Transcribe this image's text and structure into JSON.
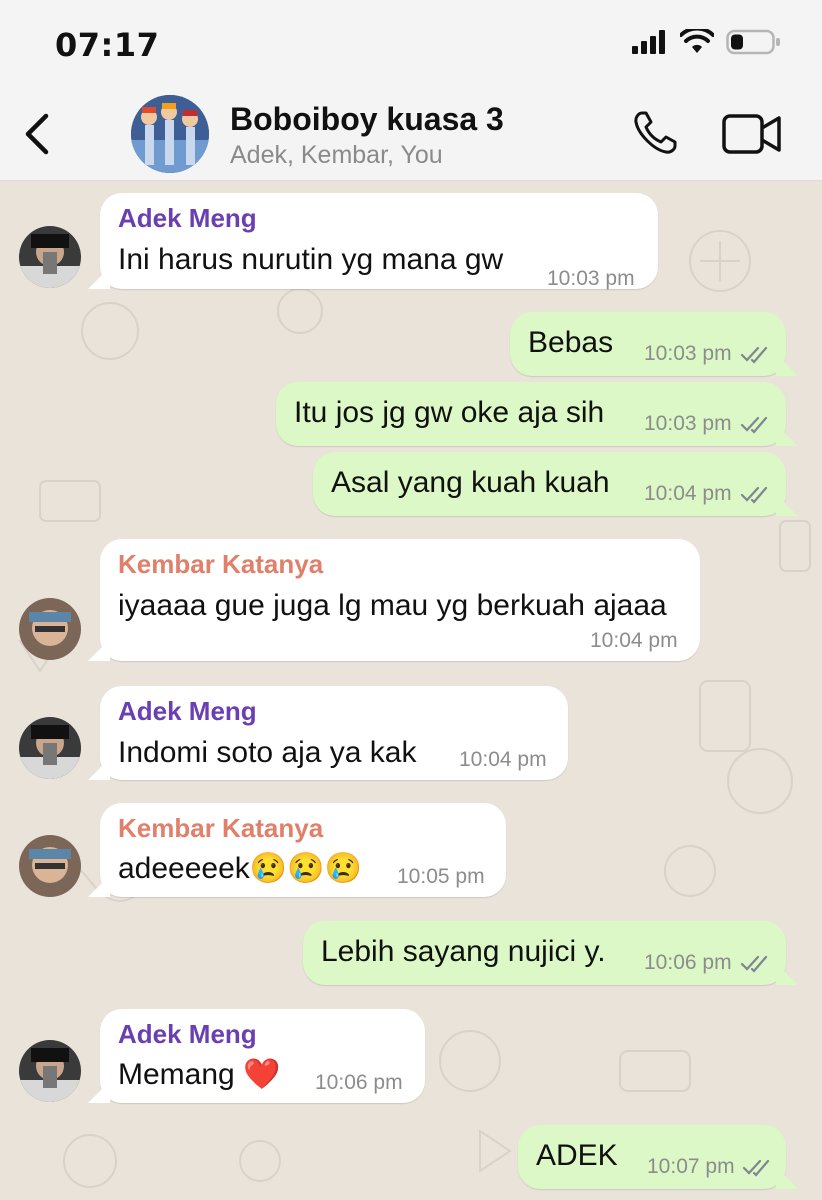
{
  "status_bar": {
    "time": "07:17"
  },
  "header": {
    "title": "Boboiboy kuasa 3",
    "subtitle": "Adek, Kembar, You"
  },
  "colors": {
    "adek_name": "#6a3fb3",
    "kembar_name": "#e07f6a",
    "outgoing_bubble": "#dbf8c6",
    "incoming_bubble": "#ffffff",
    "read_ticks": "#7d8791"
  },
  "messages": [
    {
      "direction": "in",
      "sender": "Adek Meng",
      "text": "Ini harus nurutin yg mana gw",
      "time": "10:03 pm"
    },
    {
      "direction": "out",
      "text": "Bebas",
      "time": "10:03 pm",
      "status": "read"
    },
    {
      "direction": "out",
      "text": "Itu jos jg gw oke aja sih",
      "time": "10:03 pm",
      "status": "read"
    },
    {
      "direction": "out",
      "text": "Asal yang kuah kuah",
      "time": "10:04 pm",
      "status": "read"
    },
    {
      "direction": "in",
      "sender": "Kembar Katanya",
      "text": "iyaaaa gue juga lg mau yg berkuah ajaaa",
      "time": "10:04 pm"
    },
    {
      "direction": "in",
      "sender": "Adek Meng",
      "text": "Indomi soto aja ya kak",
      "time": "10:04 pm"
    },
    {
      "direction": "in",
      "sender": "Kembar Katanya",
      "text": "adeeeeek😢😢😢",
      "time": "10:05 pm"
    },
    {
      "direction": "out",
      "text": "Lebih sayang nujici y.",
      "time": "10:06 pm",
      "status": "read"
    },
    {
      "direction": "in",
      "sender": "Adek Meng",
      "text": "Memang ❤️",
      "time": "10:06 pm"
    },
    {
      "direction": "out",
      "text": "ADEK",
      "time": "10:07 pm",
      "status": "read"
    }
  ]
}
